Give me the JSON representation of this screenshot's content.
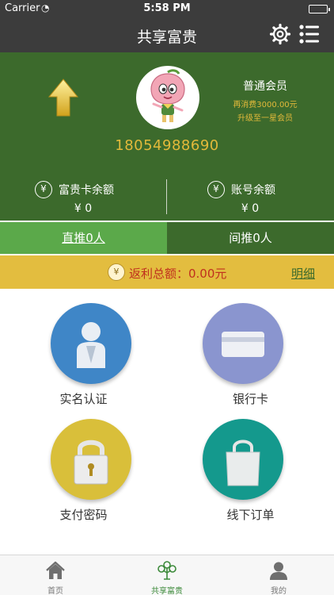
{
  "status_bar": {
    "carrier": "Carrier",
    "time": "5:58 PM"
  },
  "nav": {
    "title": "共享富贵",
    "icons": [
      "gear-icon",
      "list-icon"
    ]
  },
  "profile": {
    "member_level": "普通会员",
    "upgrade_note_1": "再消费3000.00元",
    "upgrade_note_2": "升级至一星会员",
    "phone": "18054988690",
    "card_balance_label": "富贵卡余额",
    "card_balance_value": "¥ 0",
    "account_balance_label": "账号余额",
    "account_balance_value": "¥ 0"
  },
  "referrals": {
    "direct": "直推0人",
    "indirect": "间推0人"
  },
  "rebate": {
    "label": "返利总额：0.00元",
    "detail": "明细"
  },
  "grid": [
    {
      "label": "实名认证",
      "icon": "person-icon",
      "color": "#3f86c7"
    },
    {
      "label": "银行卡",
      "icon": "card-icon",
      "color": "#8a95cf"
    },
    {
      "label": "支付密码",
      "icon": "lock-icon",
      "color": "#d9bf3a"
    },
    {
      "label": "线下订单",
      "icon": "bag-icon",
      "color": "#14998d"
    }
  ],
  "tabbar": [
    {
      "label": "首页",
      "icon": "home-icon"
    },
    {
      "label": "共享富贵",
      "icon": "tree-icon",
      "active": true
    },
    {
      "label": "我的",
      "icon": "user-icon"
    }
  ],
  "colors": {
    "header_green": "#3c6a2c",
    "tab_green": "#5ba94a",
    "gold": "#e2b93a",
    "rebate_red": "#c0301e"
  }
}
